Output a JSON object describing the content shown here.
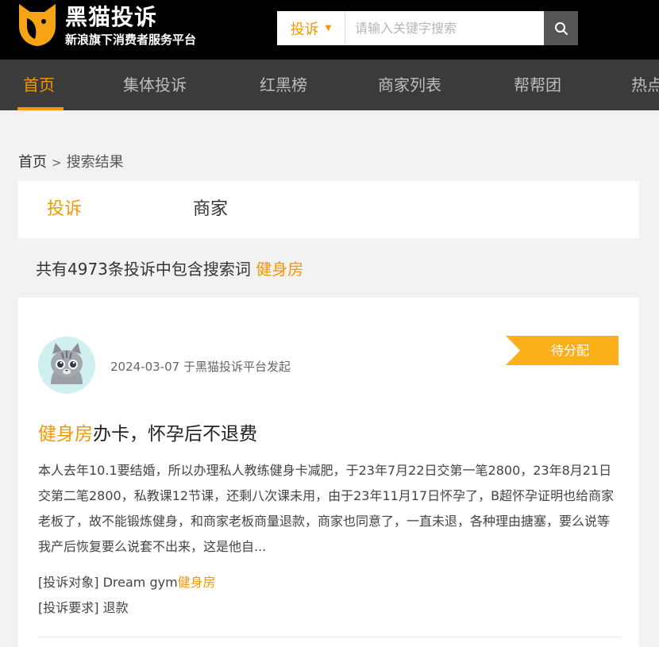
{
  "header": {
    "logo_title": "黑猫投诉",
    "logo_subtitle": "新浪旗下消费者服务平台"
  },
  "search": {
    "type_label": "投诉",
    "placeholder": "请输入关键字搜索"
  },
  "nav": {
    "items": [
      "首页",
      "集体投诉",
      "红黑榜",
      "商家列表",
      "帮帮团",
      "热点"
    ]
  },
  "breadcrumb": {
    "home": "首页",
    "separator": ">",
    "current": "搜索结果"
  },
  "tabs": [
    "投诉",
    "商家"
  ],
  "summary": {
    "text": "共有4973条投诉中包含搜索词",
    "keyword": "健身房"
  },
  "complaint": {
    "date_meta": "2024-03-07 于黑猫投诉平台发起",
    "status": "待分配",
    "title_keyword": "健身房",
    "title_rest": "办卡，怀孕后不退费",
    "content": "本人去年10.1要结婚，所以办理私人教练健身卡减肥，于23年7月22日交第一笔2800，23年8月21日交第二笔2800，私教课12节课，还剩八次课未用，由于23年11月17日怀孕了，B超怀孕证明也给商家老板了，故不能锻炼健身，和商家老板商量退款，商家也同意了，一直未退，各种理由搪塞，要么说等我产后恢复要么说套不出来，这是他自...",
    "target_label": "[投诉对象]",
    "target_value": "Dream gym",
    "target_keyword": "健身房",
    "request_label": "[投诉要求]",
    "request_value": "退款"
  },
  "colors": {
    "accent": "#f39800",
    "header_bg": "#000000",
    "nav_bg": "#3b3b3b",
    "badge_bg": "#fbb01b"
  },
  "icons": {
    "logo": "black-cat-logo-icon",
    "search": "magnifier-icon",
    "dropdown": "caret-down-icon",
    "avatar": "cat-avatar"
  }
}
